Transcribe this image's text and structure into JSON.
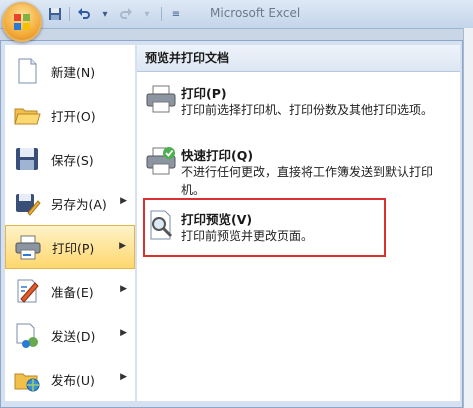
{
  "title_bar": {
    "title": "Microsoft Excel"
  },
  "quick_access": {
    "save_icon": "save-icon",
    "undo_icon": "undo-icon",
    "redo_icon": "redo-icon"
  },
  "office_menu": {
    "items": [
      {
        "label": "新建(N)",
        "icon": "new-document-icon",
        "has_submenu": false
      },
      {
        "label": "打开(O)",
        "icon": "open-folder-icon",
        "has_submenu": false
      },
      {
        "label": "保存(S)",
        "icon": "save-disk-icon",
        "has_submenu": false
      },
      {
        "label": "另存为(A)",
        "icon": "save-as-icon",
        "has_submenu": true
      },
      {
        "label": "打印(P)",
        "icon": "printer-icon",
        "has_submenu": true,
        "selected": true
      },
      {
        "label": "准备(E)",
        "icon": "prepare-icon",
        "has_submenu": true
      },
      {
        "label": "发送(D)",
        "icon": "send-icon",
        "has_submenu": true
      },
      {
        "label": "发布(U)",
        "icon": "publish-icon",
        "has_submenu": true
      }
    ]
  },
  "print_panel": {
    "header": "预览并打印文档",
    "options": [
      {
        "title": "打印(P)",
        "description": "打印前选择打印机、打印份数及其他打印选项。",
        "icon": "printer-icon"
      },
      {
        "title": "快速打印(Q)",
        "description": "不进行任何更改，直接将工作簿发送到默认打印机。",
        "icon": "quick-print-icon"
      },
      {
        "title": "打印预览(V)",
        "description": "打印前预览并更改页面。",
        "icon": "print-preview-icon"
      }
    ]
  },
  "colors": {
    "highlight_box": "#d9312f",
    "selected_item": "#ffd76e"
  }
}
